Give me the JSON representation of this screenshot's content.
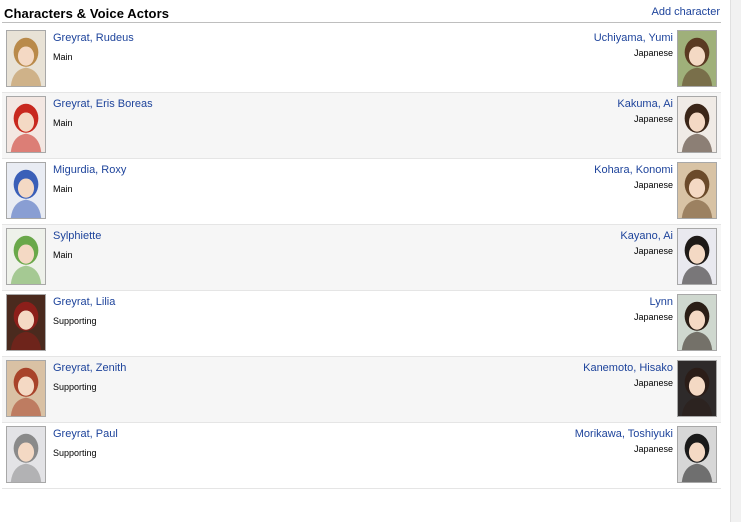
{
  "section": {
    "title": "Characters & Voice Actors",
    "add_link": "Add character"
  },
  "rows": [
    {
      "character": "Greyrat, Rudeus",
      "role": "Main",
      "voice_actor": "Uchiyama, Yumi",
      "language": "Japanese",
      "char_hair": "#b98a4a",
      "char_bg": "#e8e2d6",
      "va_hair": "#5a3a22",
      "va_bg": "#9fb07a"
    },
    {
      "character": "Greyrat, Eris Boreas",
      "role": "Main",
      "voice_actor": "Kakuma, Ai",
      "language": "Japanese",
      "char_hair": "#c8281e",
      "char_bg": "#f3e7e2",
      "va_hair": "#3b2618",
      "va_bg": "#f0ebe6"
    },
    {
      "character": "Migurdia, Roxy",
      "role": "Main",
      "voice_actor": "Kohara, Konomi",
      "language": "Japanese",
      "char_hair": "#3a5fb8",
      "char_bg": "#e9ecf3",
      "va_hair": "#6b4a2a",
      "va_bg": "#d8c3a5"
    },
    {
      "character": "Sylphiette",
      "role": "Main",
      "voice_actor": "Kayano, Ai",
      "language": "Japanese",
      "char_hair": "#6aa84a",
      "char_bg": "#eef1ea",
      "va_hair": "#1e1a18",
      "va_bg": "#e9e9ef"
    },
    {
      "character": "Greyrat, Lilia",
      "role": "Supporting",
      "voice_actor": "Lynn",
      "language": "Japanese",
      "char_hair": "#8c1f1a",
      "char_bg": "#4a2a1e",
      "va_hair": "#2a1e16",
      "va_bg": "#cfd8cf"
    },
    {
      "character": "Greyrat, Zenith",
      "role": "Supporting",
      "voice_actor": "Kanemoto, Hisako",
      "language": "Japanese",
      "char_hair": "#a8432a",
      "char_bg": "#d9c1a4",
      "va_hair": "#2b1d18",
      "va_bg": "#2e2a2a"
    },
    {
      "character": "Greyrat, Paul",
      "role": "Supporting",
      "voice_actor": "Morikawa, Toshiyuki",
      "language": "Japanese",
      "char_hair": "#8a8a8a",
      "char_bg": "#e3e3e6",
      "va_hair": "#1a1a1a",
      "va_bg": "#d7d7d7"
    }
  ]
}
